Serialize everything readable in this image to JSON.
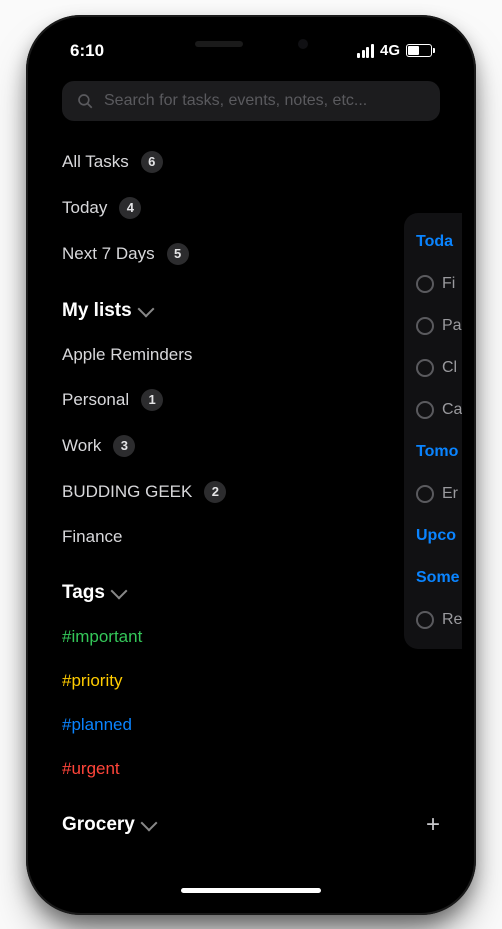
{
  "status": {
    "time": "6:10",
    "network": "4G"
  },
  "search": {
    "placeholder": "Search for tasks, events, notes, etc..."
  },
  "smartLists": [
    {
      "label": "All Tasks",
      "count": "6"
    },
    {
      "label": "Today",
      "count": "4"
    },
    {
      "label": "Next 7 Days",
      "count": "5"
    }
  ],
  "myLists": {
    "title": "My lists",
    "items": [
      {
        "label": "Apple Reminders",
        "count": null
      },
      {
        "label": "Personal",
        "count": "1"
      },
      {
        "label": "Work",
        "count": "3"
      },
      {
        "label": "BUDDING GEEK",
        "count": "2"
      },
      {
        "label": "Finance",
        "count": null
      }
    ]
  },
  "tags": {
    "title": "Tags",
    "items": [
      {
        "label": "#important",
        "color": "green"
      },
      {
        "label": "#priority",
        "color": "yellow"
      },
      {
        "label": "#planned",
        "color": "blue"
      },
      {
        "label": "#urgent",
        "color": "red"
      }
    ]
  },
  "grocery": {
    "title": "Grocery"
  },
  "sidePanel": {
    "sections": [
      {
        "header": "Toda",
        "items": [
          "Fi",
          "Pa",
          "Cl",
          "Ca"
        ]
      },
      {
        "header": "Tomo",
        "items": [
          "Er"
        ]
      },
      {
        "header": "Upco",
        "items": []
      },
      {
        "header": "Some",
        "items": [
          "Re"
        ]
      }
    ]
  }
}
